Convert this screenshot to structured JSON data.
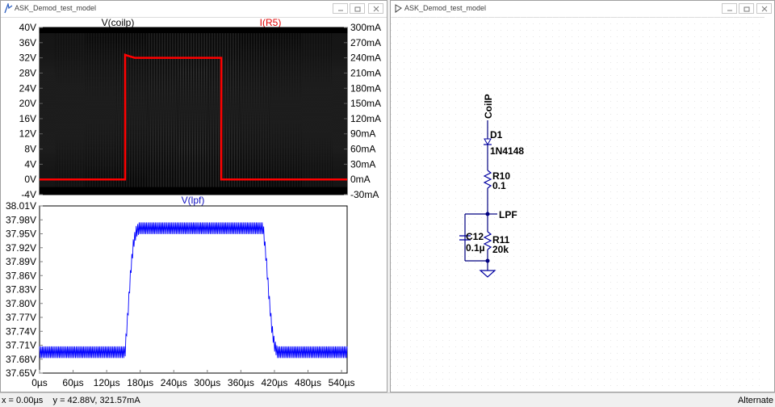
{
  "waveform_window": {
    "title": "ASK_Demod_test_model",
    "top_pane": {
      "trace1_label": "V(coilp)",
      "trace2_label": "I(R5)",
      "left_ticks": [
        "40V",
        "36V",
        "32V",
        "28V",
        "24V",
        "20V",
        "16V",
        "12V",
        "8V",
        "4V",
        "0V",
        "-4V"
      ],
      "right_ticks": [
        "300mA",
        "270mA",
        "240mA",
        "210mA",
        "180mA",
        "150mA",
        "120mA",
        "90mA",
        "60mA",
        "30mA",
        "0mA",
        "-30mA"
      ],
      "trace1_color": "#000000",
      "trace2_color": "#ff0000"
    },
    "bottom_pane": {
      "trace_label": "V(lpf)",
      "trace_color": "#0000ff",
      "left_ticks": [
        "38.01V",
        "37.98V",
        "37.95V",
        "37.92V",
        "37.89V",
        "37.86V",
        "37.83V",
        "37.80V",
        "37.77V",
        "37.74V",
        "37.71V",
        "37.68V",
        "37.65V"
      ],
      "x_ticks": [
        "0µs",
        "60µs",
        "120µs",
        "180µs",
        "240µs",
        "300µs",
        "360µs",
        "420µs",
        "480µs",
        "540µs"
      ]
    }
  },
  "chart_data": [
    {
      "type": "line",
      "x_unit": "µs",
      "x_range": [
        0,
        550
      ],
      "y_left_range": [
        -4,
        40
      ],
      "y_right_range": [
        -30,
        300
      ],
      "series": [
        {
          "name": "V(coilp)",
          "axis": "left",
          "envelope_min": -2,
          "envelope_max": 38.5,
          "note_shape": "dense oscillation"
        },
        {
          "name": "I(R5)",
          "axis": "right",
          "x": [
            0,
            153,
            153,
            158,
            170,
            325,
            325,
            550
          ],
          "y": [
            0,
            0,
            246,
            244,
            240,
            240,
            0,
            0
          ]
        }
      ]
    },
    {
      "type": "line",
      "x_unit": "µs",
      "x_range": [
        0,
        550
      ],
      "y_range": [
        37.65,
        38.01
      ],
      "series": [
        {
          "name": "V(lpf)",
          "x": [
            0,
            153,
            158,
            163,
            168,
            173,
            178,
            400,
            405,
            410,
            415,
            420,
            425,
            550
          ],
          "y_mid": [
            37.695,
            37.695,
            37.78,
            37.87,
            37.93,
            37.955,
            37.962,
            37.962,
            37.9,
            37.82,
            37.75,
            37.71,
            37.695,
            37.695
          ],
          "ripple": 0.025
        }
      ]
    }
  ],
  "schematic_window": {
    "title": "ASK_Demod_test_model",
    "net_coilp": "CoilP",
    "d1_name": "D1",
    "d1_value": "1N4148",
    "r10_name": "R10",
    "r10_value": "0.1",
    "net_lpf": "LPF",
    "c12_name": "C12",
    "c12_value": "0.1µ",
    "r11_name": "R11",
    "r11_value": "20k"
  },
  "status": {
    "cursor_readout": "x = 0.00µs    y = 42.88V, 321.57mA",
    "mode": "Alternate"
  }
}
